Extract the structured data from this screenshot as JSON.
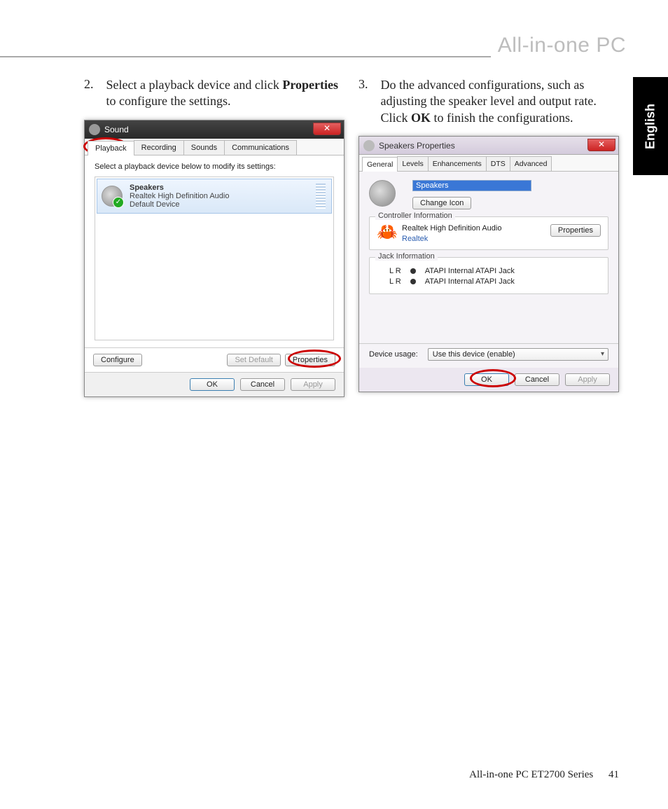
{
  "page": {
    "header_title": "All-in-one PC",
    "language_tab": "English",
    "footer_text": "All-in-one PC ET2700 Series",
    "page_number": "41"
  },
  "steps": {
    "s2": {
      "num": "2.",
      "pre": "Select a playback device and click ",
      "bold": "Properties",
      "post": " to configure the settings."
    },
    "s3": {
      "num": "3.",
      "pre": "Do the advanced configurations, such as adjusting the speaker level and output rate. Click ",
      "bold": "OK",
      "post": " to finish the configurations."
    }
  },
  "sound_dialog": {
    "title": "Sound",
    "tabs": [
      "Playback",
      "Recording",
      "Sounds",
      "Communications"
    ],
    "instruction": "Select a playback device below to modify its settings:",
    "device": {
      "name": "Speakers",
      "driver": "Realtek High Definition Audio",
      "status": "Default Device"
    },
    "buttons": {
      "configure": "Configure",
      "set_default": "Set Default",
      "properties": "Properties",
      "ok": "OK",
      "cancel": "Cancel",
      "apply": "Apply"
    }
  },
  "props_dialog": {
    "title": "Speakers Properties",
    "tabs": [
      "General",
      "Levels",
      "Enhancements",
      "DTS",
      "Advanced"
    ],
    "name_value": "Speakers",
    "change_icon": "Change Icon",
    "groups": {
      "controller": {
        "title": "Controller Information",
        "line1": "Realtek High Definition Audio",
        "vendor": "Realtek",
        "properties": "Properties"
      },
      "jack": {
        "title": "Jack Information",
        "lr": "L R",
        "entry": "ATAPI Internal ATAPI Jack"
      }
    },
    "usage": {
      "label": "Device usage:",
      "value": "Use this device (enable)"
    },
    "buttons": {
      "ok": "OK",
      "cancel": "Cancel",
      "apply": "Apply"
    }
  }
}
